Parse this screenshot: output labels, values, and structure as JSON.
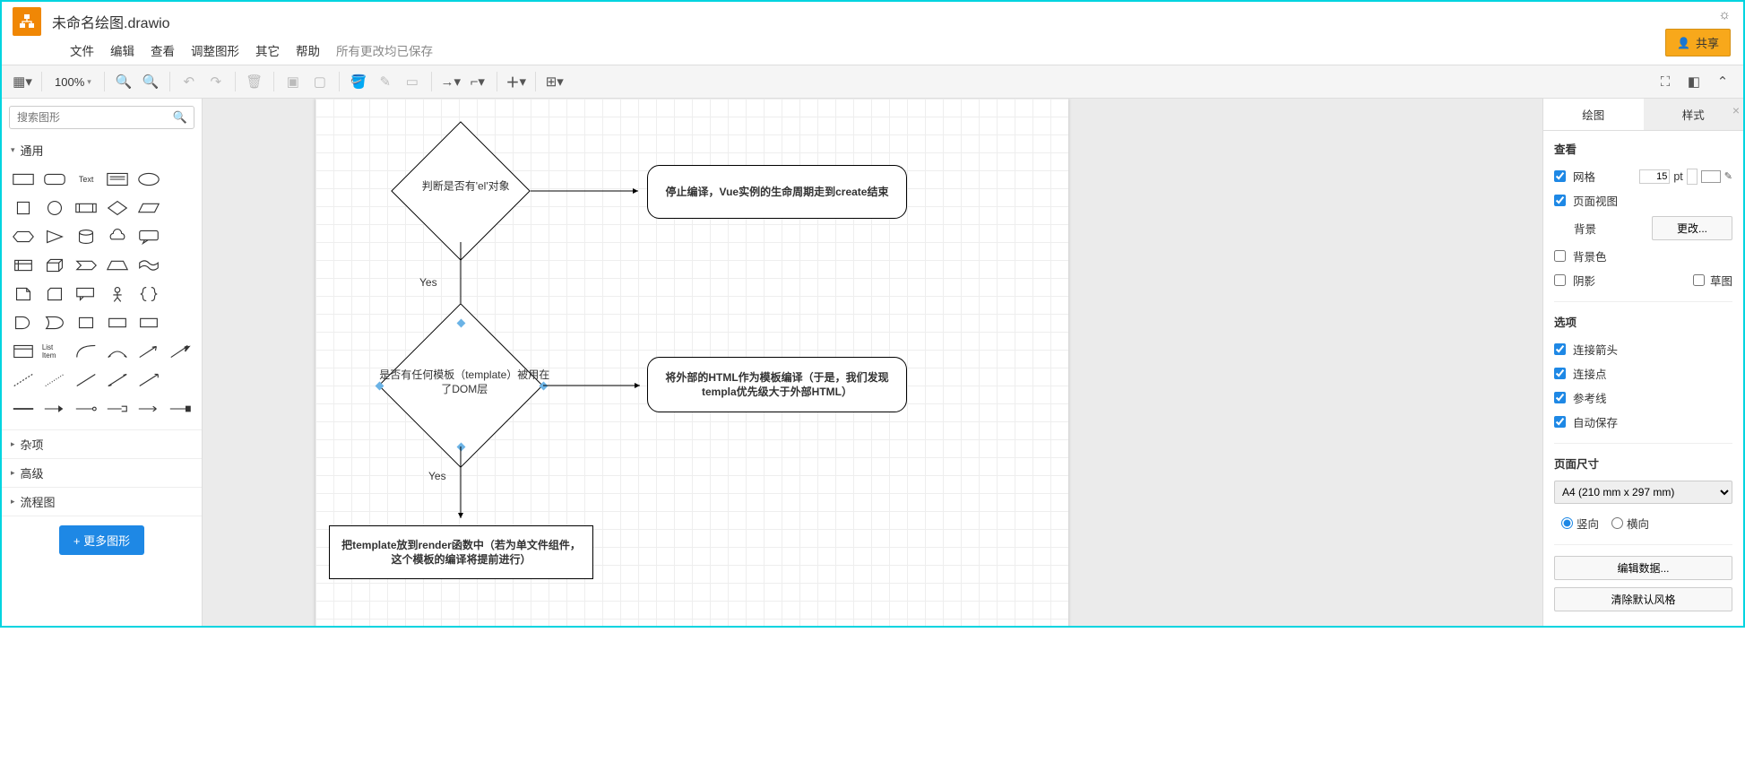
{
  "title": "未命名绘图.drawio",
  "menu": {
    "file": "文件",
    "edit": "编辑",
    "view": "查看",
    "arrange": "调整图形",
    "extras": "其它",
    "help": "帮助",
    "saved": "所有更改均已保存"
  },
  "share": "共享",
  "zoom": "100%",
  "sidebar": {
    "search_placeholder": "搜索图形",
    "sections": {
      "general": "通用",
      "misc": "杂项",
      "advanced": "高级",
      "flowchart": "流程图"
    },
    "more_shapes": "更多图形"
  },
  "canvas": {
    "diamond1": "判断是否有'el'对象",
    "round1": "停止编译，Vue实例的生命周期走到create结束",
    "diamond2": "是否有任何模板（template）被用在了DOM层",
    "round2": "将外部的HTML作为模板编译（于是，我们发现templa优先级大于外部HTML）",
    "rect3": "把template放到render函数中（若为单文件组件，这个模板的编译将提前进行）",
    "yes1": "Yes",
    "yes2": "Yes"
  },
  "panel": {
    "tab_diagram": "绘图",
    "tab_style": "样式",
    "section_view": "查看",
    "grid": "网格",
    "grid_size": "15",
    "grid_unit": "pt",
    "page_view": "页面视图",
    "background": "背景",
    "change": "更改...",
    "bg_color": "背景色",
    "shadow": "阴影",
    "sketch": "草图",
    "section_options": "选项",
    "conn_arrows": "连接箭头",
    "conn_points": "连接点",
    "guides": "参考线",
    "autosave": "自动保存",
    "section_pagesize": "页面尺寸",
    "pagesize_value": "A4 (210 mm x 297 mm)",
    "portrait": "竖向",
    "landscape": "横向",
    "edit_data": "编辑数据...",
    "clear_style": "清除默认风格"
  }
}
